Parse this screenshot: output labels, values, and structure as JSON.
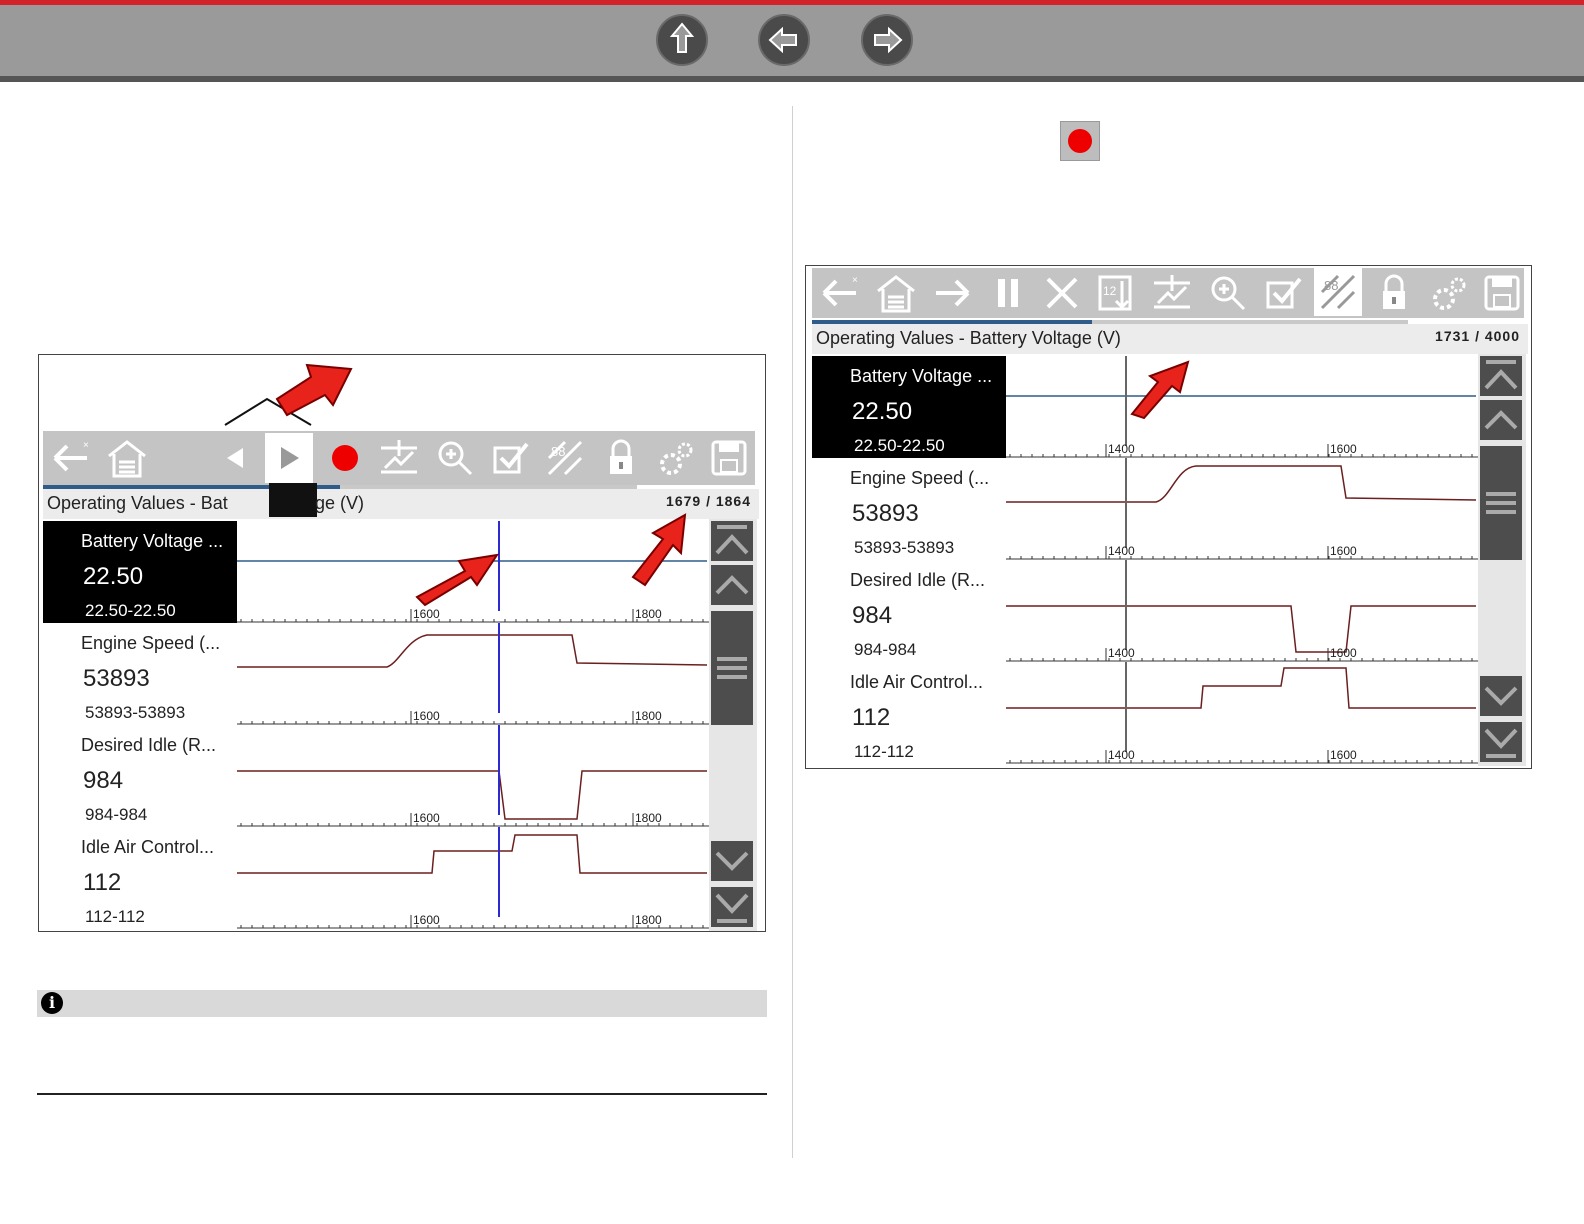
{
  "nav": {
    "home_icon": "up-arrow-icon",
    "back_icon": "left-arrow-icon",
    "forward_icon": "right-arrow-icon"
  },
  "colors": {
    "accent_red": "#d2232a",
    "toolbar_gray": "#c4c4c4",
    "selected_row": "#000000",
    "cursor_blue": "#2b2bd1",
    "trace": "#6b1f1f"
  },
  "left_screen": {
    "header_title": "Operating Values - Bat",
    "header_title_tail": "ge (V)",
    "record_count": "1679 / 1864",
    "progress": 0.5,
    "toolbar_icons": [
      "back-icon",
      "home-icon",
      "previous-frame-icon",
      "play-icon",
      "record-icon",
      "graph-scale-icon",
      "zoom-icon",
      "select-icon",
      "split-view-icon",
      "lock-icon",
      "settings-icon",
      "save-icon"
    ],
    "rows": [
      {
        "name": "Battery Voltage ...",
        "value": "22.50",
        "range": "22.50-22.50",
        "tick1": "1600",
        "tick2": "1800"
      },
      {
        "name": "Engine Speed (...",
        "value": "53893",
        "range": "53893-53893",
        "tick1": "1600",
        "tick2": "1800"
      },
      {
        "name": "Desired Idle (R...",
        "value": "984",
        "range": "984-984",
        "tick1": "1600",
        "tick2": "1800"
      },
      {
        "name": "Idle Air Control...",
        "value": "112",
        "range": "112-112",
        "tick1": "1600",
        "tick2": "1800"
      }
    ]
  },
  "right_screen": {
    "header_title": "Operating Values - Battery Voltage (V)",
    "record_count": "1731 / 4000",
    "progress": 0.47,
    "toolbar_icons": [
      "back-icon",
      "home-icon",
      "forward-icon",
      "pause-icon",
      "clear-icon",
      "sort-icon",
      "graph-scale-icon",
      "zoom-icon",
      "select-icon",
      "split-view-icon",
      "lock-icon",
      "settings-icon",
      "save-icon"
    ],
    "rows": [
      {
        "name": "Battery Voltage ...",
        "value": "22.50",
        "range": "22.50-22.50",
        "tick1": "1400",
        "tick2": "1600"
      },
      {
        "name": "Engine Speed (...",
        "value": "53893",
        "range": "53893-53893",
        "tick1": "1400",
        "tick2": "1600"
      },
      {
        "name": "Desired Idle (R...",
        "value": "984",
        "range": "984-984",
        "tick1": "1400",
        "tick2": "1600"
      },
      {
        "name": "Idle Air Control...",
        "value": "112",
        "range": "112-112",
        "tick1": "1400",
        "tick2": "1600"
      }
    ]
  },
  "note": {
    "icon": "info-icon",
    "icon_glyph": "i"
  }
}
